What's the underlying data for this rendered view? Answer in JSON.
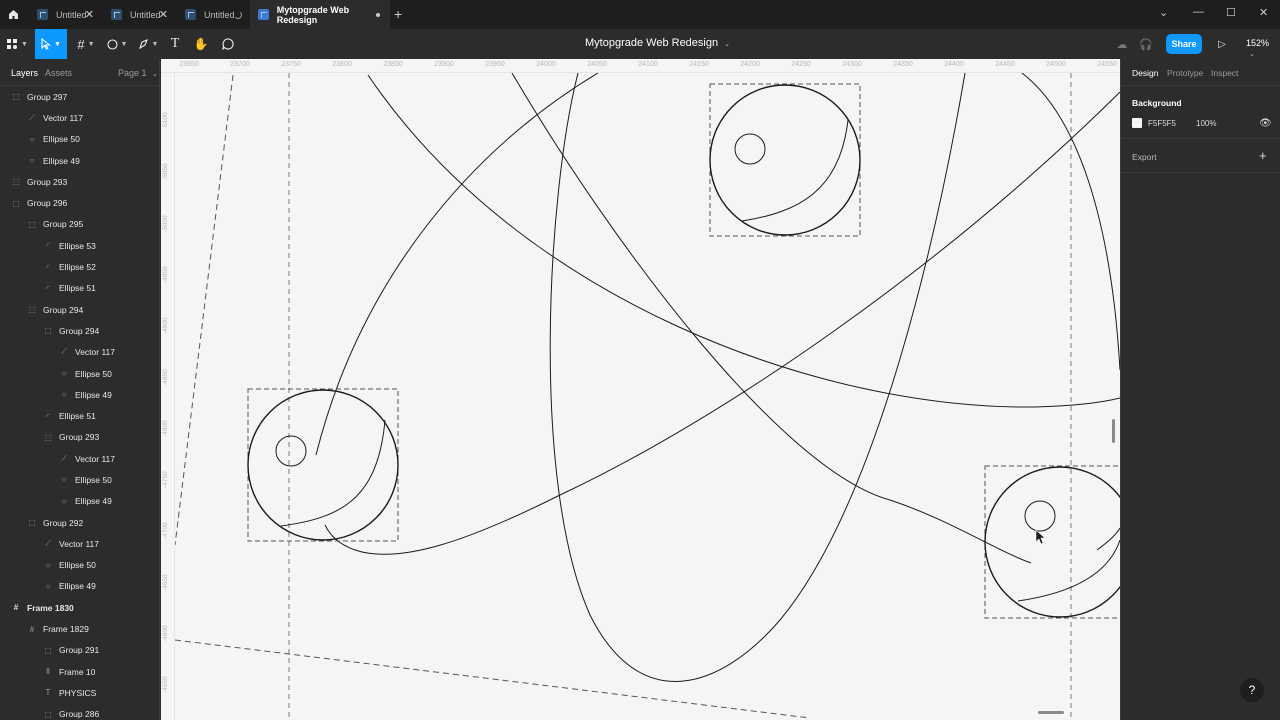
{
  "tabs": [
    {
      "title": "Untitled",
      "status": "close"
    },
    {
      "title": "Untitled",
      "status": "close"
    },
    {
      "title": "Untitled",
      "status": "loading"
    },
    {
      "title": "Mytopgrade Web Redesign",
      "status": "unsaved"
    }
  ],
  "toolbar": {
    "file_title": "Mytopgrade Web Redesign",
    "share_label": "Share",
    "zoom": "152%"
  },
  "left_panel": {
    "tabs": [
      "Layers",
      "Assets"
    ],
    "page": "Page 1",
    "layers": [
      {
        "name": "Group 297",
        "icon": "group-icon",
        "indent": 0
      },
      {
        "name": "Vector 117",
        "icon": "vector-icon",
        "indent": 1
      },
      {
        "name": "Ellipse 50",
        "icon": "ellipse-icon",
        "indent": 1
      },
      {
        "name": "Ellipse 49",
        "icon": "ellipse-icon",
        "indent": 1
      },
      {
        "name": "Group 293",
        "icon": "group-icon",
        "indent": 0
      },
      {
        "name": "Group 296",
        "icon": "group-icon",
        "indent": 0
      },
      {
        "name": "Group 295",
        "icon": "group-icon",
        "indent": 1
      },
      {
        "name": "Ellipse 53",
        "icon": "ellipse-arc-icon",
        "indent": 2
      },
      {
        "name": "Ellipse 52",
        "icon": "ellipse-arc-icon",
        "indent": 2
      },
      {
        "name": "Ellipse 51",
        "icon": "ellipse-arc-icon",
        "indent": 2
      },
      {
        "name": "Group 294",
        "icon": "group-icon",
        "indent": 1
      },
      {
        "name": "Group 294",
        "icon": "group-icon",
        "indent": 2
      },
      {
        "name": "Vector 117",
        "icon": "vector-icon",
        "indent": 3
      },
      {
        "name": "Ellipse 50",
        "icon": "ellipse-icon",
        "indent": 3
      },
      {
        "name": "Ellipse 49",
        "icon": "ellipse-icon",
        "indent": 3
      },
      {
        "name": "Ellipse 51",
        "icon": "ellipse-arc-icon",
        "indent": 2
      },
      {
        "name": "Group 293",
        "icon": "group-icon",
        "indent": 2
      },
      {
        "name": "Vector 117",
        "icon": "vector-icon",
        "indent": 3
      },
      {
        "name": "Ellipse 50",
        "icon": "ellipse-icon",
        "indent": 3
      },
      {
        "name": "Ellipse 49",
        "icon": "ellipse-icon",
        "indent": 3
      },
      {
        "name": "Group 292",
        "icon": "group-icon",
        "indent": 1
      },
      {
        "name": "Vector 117",
        "icon": "vector-icon",
        "indent": 2
      },
      {
        "name": "Ellipse 50",
        "icon": "ellipse-icon",
        "indent": 2
      },
      {
        "name": "Ellipse 49",
        "icon": "ellipse-icon",
        "indent": 2
      },
      {
        "name": "Frame 1830",
        "icon": "frame-icon",
        "indent": 0
      },
      {
        "name": "Frame 1829",
        "icon": "frame-icon",
        "indent": 1
      },
      {
        "name": "Group 291",
        "icon": "group-icon",
        "indent": 2
      },
      {
        "name": "Frame 10",
        "icon": "auto-layout-icon",
        "indent": 2
      },
      {
        "name": "PHYSICS",
        "icon": "text-icon",
        "indent": 2
      },
      {
        "name": "Group 286",
        "icon": "group-icon",
        "indent": 2
      }
    ]
  },
  "ruler": {
    "top": [
      "23650",
      "23700",
      "23750",
      "23800",
      "23850",
      "23900",
      "23950",
      "24000",
      "24050",
      "24100",
      "24150",
      "24200",
      "24250",
      "24300",
      "24350",
      "24400",
      "24450",
      "24500",
      "24550"
    ],
    "left": [
      "-5100",
      "-5050",
      "-5000",
      "-4950",
      "-4900",
      "-4850",
      "-4800",
      "-4750",
      "-4700",
      "-4650",
      "-4600",
      "-4550"
    ]
  },
  "right_panel": {
    "tabs": [
      "Design",
      "Prototype",
      "Inspect"
    ],
    "background_label": "Background",
    "background_hex": "F5F5F5",
    "background_opacity": "100%",
    "export_label": "Export"
  },
  "colors": {
    "accent": "#0d99ff",
    "canvas": "#f5f5f5",
    "ui_bg": "#2c2c2c",
    "tabbar_bg": "#1e1e1e"
  }
}
